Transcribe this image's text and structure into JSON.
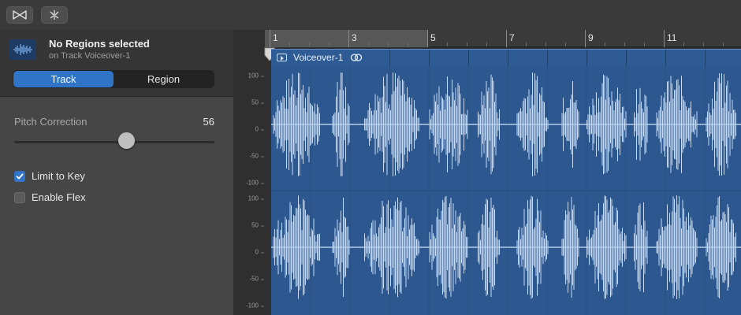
{
  "toolbar": {
    "buttons": [
      {
        "icon": "bowtie-icon"
      },
      {
        "icon": "scissors-split-icon"
      }
    ]
  },
  "inspector": {
    "title": "No Regions selected",
    "subtitle": "on Track Voiceover-1",
    "tabs": [
      {
        "label": "Track",
        "active": true
      },
      {
        "label": "Region",
        "active": false
      }
    ],
    "pitch_correction": {
      "label": "Pitch Correction",
      "value": "56",
      "fraction": 0.56
    },
    "checkboxes": [
      {
        "label": "Limit to Key",
        "checked": true
      },
      {
        "label": "Enable Flex",
        "checked": false
      }
    ]
  },
  "ruler": {
    "bars": [
      "1",
      "3",
      "5",
      "7",
      "9",
      "11"
    ]
  },
  "region": {
    "name": "Voiceover-1"
  },
  "waveform": {
    "y_labels": [
      "100",
      "50",
      "0",
      "-50",
      "-100"
    ],
    "colors": {
      "region": "#2d578f",
      "wave": "#c7dbf4",
      "accent": "#2f74c7"
    }
  }
}
